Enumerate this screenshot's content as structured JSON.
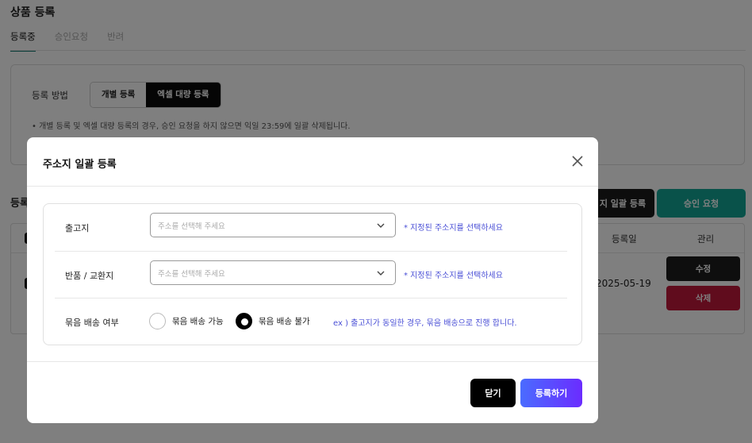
{
  "page": {
    "title": "상품 등록",
    "tabs": [
      {
        "label": "등록중",
        "active": true
      },
      {
        "label": "승인요청",
        "active": false
      },
      {
        "label": "반려",
        "active": false
      }
    ],
    "method": {
      "label": "등록 방법",
      "options": [
        {
          "label": "개별 등록",
          "active": false
        },
        {
          "label": "엑셀 대량 등록",
          "active": true
        }
      ],
      "notice_line1": "• 개별 등록 및 엑셀 대량 등록의 경우, 승인 요청을 하지 않으면 익일 23:59에 일괄 삭제됩니다."
    },
    "list": {
      "title": "등록",
      "bulk_button": "지 일괄 등록",
      "approve_button": "승인 요청",
      "headers": {
        "reg_date": "등록일",
        "manage": "관리"
      },
      "rows": [
        {
          "reg_date": "2025-05-19",
          "edit": "수정",
          "delete": "삭제"
        }
      ]
    }
  },
  "modal": {
    "title": "주소지 일괄 등록",
    "warehouse": {
      "label": "출고지",
      "placeholder": "주소를 선택해 주세요",
      "hint": "* 지정된 주소지를 선택하세요"
    },
    "return": {
      "label": "반품 / 교환지",
      "placeholder": "주소를 선택해 주세요",
      "hint": "* 지정된 주소지를 선택하세요"
    },
    "bundle": {
      "label": "묶음 배송 여부",
      "options": [
        {
          "label": "묶음 배송 가능",
          "selected": false
        },
        {
          "label": "묶음 배송 불가",
          "selected": true
        }
      ],
      "hint": "ex ) 출고지가 동일한 경우, 묶음 배송으로 진행 합니다."
    },
    "buttons": {
      "close": "닫기",
      "submit": "등록하기"
    }
  }
}
